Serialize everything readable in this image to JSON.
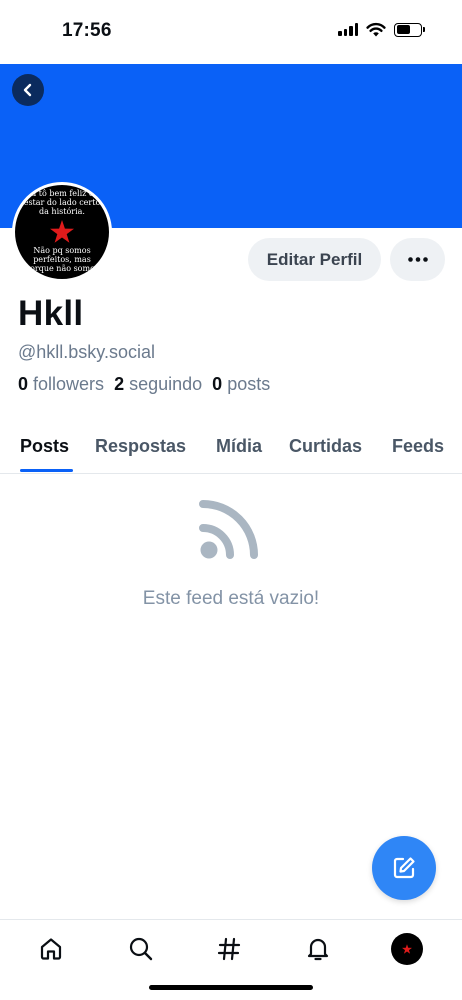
{
  "status_bar": {
    "time": "17:56"
  },
  "profile": {
    "display_name": "Hkll",
    "handle": "@hkll.bsky.social",
    "avatar_text_top": "Eu tô bem feliz de estar do lado certo da história.",
    "avatar_text_bottom": "Não pq somos perfeitos, mas porque não somos",
    "stats": {
      "followers_count": "0",
      "followers_label": "followers",
      "following_count": "2",
      "following_label": "seguindo",
      "posts_count": "0",
      "posts_label": "posts"
    }
  },
  "actions": {
    "edit_label": "Editar Perfil",
    "more_icon": "more-horizontal-icon"
  },
  "tabs": [
    {
      "label": "Posts",
      "active": true
    },
    {
      "label": "Respostas",
      "active": false
    },
    {
      "label": "Mídia",
      "active": false
    },
    {
      "label": "Curtidas",
      "active": false
    },
    {
      "label": "Feeds",
      "active": false
    }
  ],
  "empty_state": {
    "icon": "rss-icon",
    "text": "Este feed está vazio!"
  },
  "bottom_nav": [
    "home-icon",
    "search-icon",
    "hashtag-icon",
    "bell-icon",
    "profile-avatar"
  ],
  "colors": {
    "banner": "#0a61f7",
    "accent": "#0a61f7",
    "fab": "#2f86f6",
    "muted_text": "#6b7a8d"
  }
}
